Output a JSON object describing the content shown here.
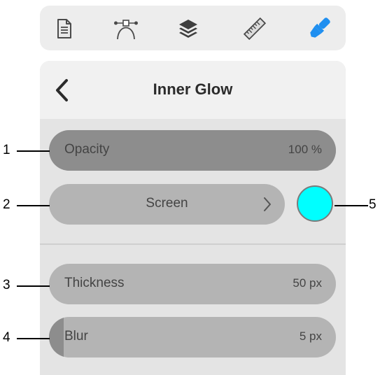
{
  "toolbar": {
    "icons": [
      "document-icon",
      "bezier-curve-icon",
      "layers-icon",
      "ruler-icon",
      "paintbrush-icon"
    ],
    "active_color": "#1f8ff0",
    "inactive_color": "#4a4a4a"
  },
  "panel": {
    "title": "Inner Glow",
    "back_icon": "chevron-left-icon"
  },
  "controls": {
    "opacity": {
      "label": "Opacity",
      "value": "100 %",
      "fill_fraction": 1.0
    },
    "blend_mode": {
      "label": "Screen"
    },
    "color": {
      "value": "#00ffff"
    },
    "thickness": {
      "label": "Thickness",
      "value": "50 px",
      "fill_fraction": 0.0
    },
    "blur": {
      "label": "Blur",
      "value": "5 px",
      "fill_fraction": 0.05
    }
  },
  "callouts": [
    "1",
    "2",
    "3",
    "4",
    "5"
  ]
}
